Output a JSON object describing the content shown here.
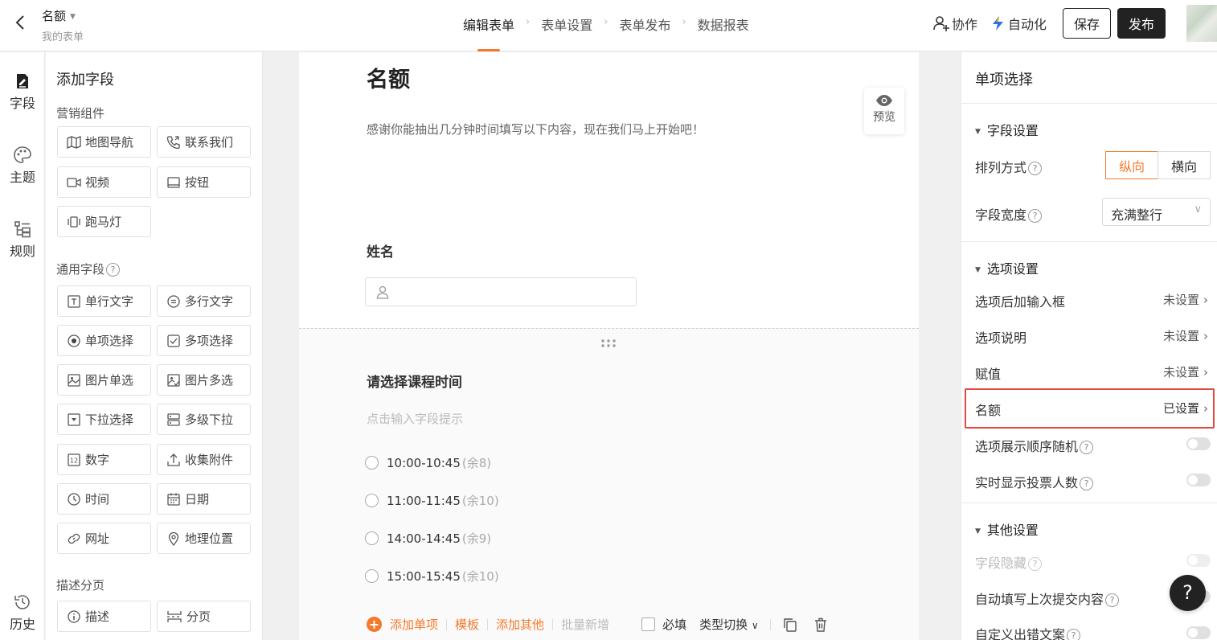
{
  "header": {
    "title": "名额",
    "subtitle": "我的表单",
    "steps": [
      "编辑表单",
      "表单设置",
      "表单发布",
      "数据报表"
    ],
    "collab": "协作",
    "automation": "自动化",
    "save": "保存",
    "publish": "发布"
  },
  "rail": {
    "fields": "字段",
    "theme": "主题",
    "rules": "规则",
    "history": "历史"
  },
  "field_panel": {
    "title": "添加字段",
    "marketing_label": "营销组件",
    "marketing": [
      "地图导航",
      "联系我们",
      "视频",
      "按钮",
      "跑马灯"
    ],
    "general_label": "通用字段",
    "general": [
      "单行文字",
      "多行文字",
      "单项选择",
      "多项选择",
      "图片单选",
      "图片多选",
      "下拉选择",
      "多级下拉",
      "数字",
      "收集附件",
      "时间",
      "日期",
      "网址",
      "地理位置"
    ],
    "desc_label": "描述分页",
    "desc": [
      "描述",
      "分页"
    ]
  },
  "canvas": {
    "title": "名额",
    "description": "感谢你能抽出几分钟时间填写以下内容，现在我们马上开始吧！",
    "preview": "预览",
    "q1_label": "姓名",
    "q2_label": "请选择课程时间",
    "q2_hint": "点击输入字段提示",
    "options": [
      {
        "time": "10:00-10:45",
        "remain": "(余8)"
      },
      {
        "time": "11:00-11:45",
        "remain": "(余10)"
      },
      {
        "time": "14:00-14:45",
        "remain": "(余9)"
      },
      {
        "time": "15:00-15:45",
        "remain": "(余10)"
      }
    ],
    "toolbar": {
      "add_option": "添加单项",
      "template": "模板",
      "add_other": "添加其他",
      "batch_add": "批量新增",
      "required": "必填",
      "type_switch": "类型切换"
    }
  },
  "right_panel": {
    "title": "单项选择",
    "field_settings": "字段设置",
    "layout_label": "排列方式",
    "layout_vertical": "纵向",
    "layout_horizontal": "横向",
    "width_label": "字段宽度",
    "width_value": "充满整行",
    "option_settings": "选项设置",
    "rows": [
      {
        "label": "选项后加输入框",
        "value": "未设置"
      },
      {
        "label": "选项说明",
        "value": "未设置"
      },
      {
        "label": "赋值",
        "value": "未设置"
      },
      {
        "label": "名额",
        "value": "已设置"
      }
    ],
    "random_order": "选项展示顺序随机",
    "show_votes": "实时显示投票人数",
    "other_settings": "其他设置",
    "hide_field": "字段隐藏",
    "autofill": "自动填写上次提交内容",
    "custom_error": "自定义出错文案"
  },
  "help_fab": "?"
}
